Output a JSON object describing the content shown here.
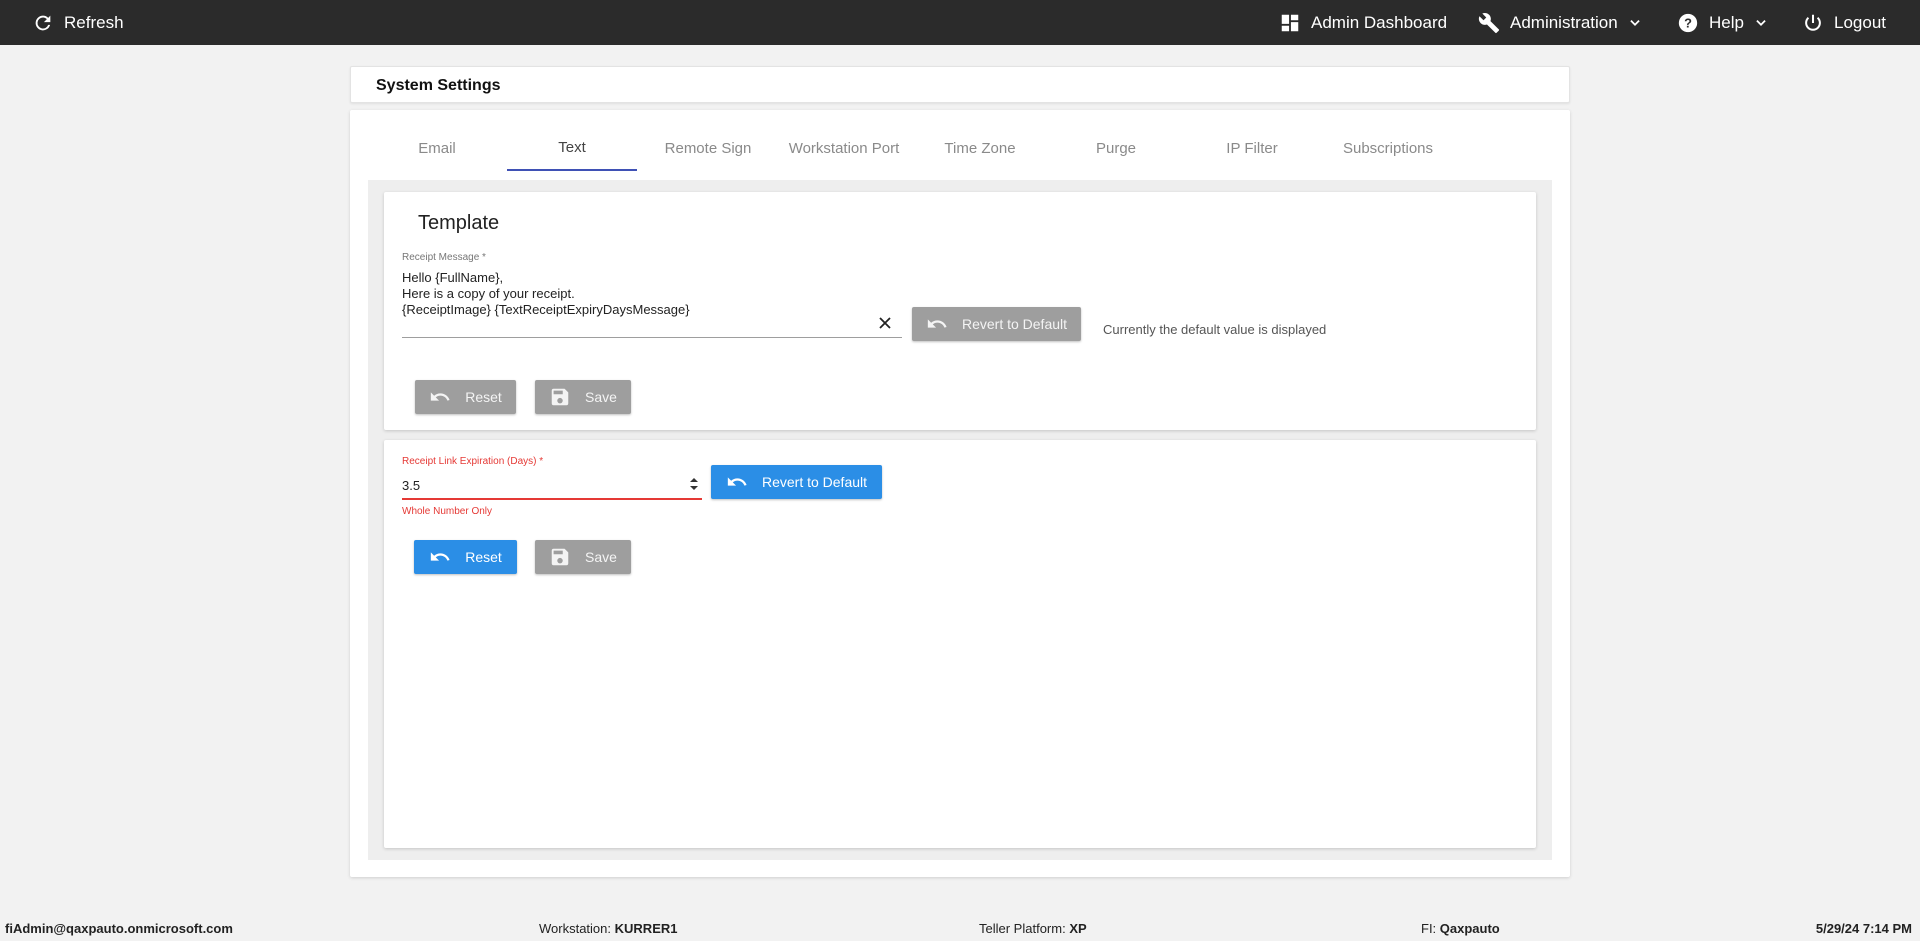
{
  "topbar": {
    "refresh_label": "Refresh",
    "admin_dashboard_label": "Admin Dashboard",
    "administration_label": "Administration",
    "help_label": "Help",
    "logout_label": "Logout",
    "icons": [
      "refresh-icon",
      "dashboard-icon",
      "wrench-icon",
      "help-circle-icon",
      "power-icon",
      "chevron-down-icon"
    ]
  },
  "page_title": "System Settings",
  "tabs": [
    {
      "label": "Email",
      "active": false
    },
    {
      "label": "Text",
      "active": true
    },
    {
      "label": "Remote Sign",
      "active": false
    },
    {
      "label": "Workstation Port",
      "active": false
    },
    {
      "label": "Time Zone",
      "active": false
    },
    {
      "label": "Purge",
      "active": false
    },
    {
      "label": "IP Filter",
      "active": false
    },
    {
      "label": "Subscriptions",
      "active": false
    }
  ],
  "template_section": {
    "title": "Template",
    "receipt_message_label": "Receipt Message *",
    "receipt_message_value": "Hello {FullName},\nHere is a copy of your receipt.\n{ReceiptImage} {TextReceiptExpiryDaysMessage}",
    "revert_label": "Revert to Default",
    "default_note": "Currently the default value is displayed",
    "reset_label": "Reset",
    "save_label": "Save"
  },
  "expiration_section": {
    "label": "Receipt Link Expiration (Days) *",
    "value": "3.5",
    "error": "Whole Number Only",
    "revert_label": "Revert to Default",
    "reset_label": "Reset",
    "save_label": "Save"
  },
  "footer": {
    "user": "fiAdmin@qaxpauto.onmicrosoft.com",
    "workstation_label": "Workstation:",
    "workstation_value": "KURRER1",
    "platform_label": "Teller Platform:",
    "platform_value": "XP",
    "fi_label": "FI:",
    "fi_value": "Qaxpauto",
    "datetime": "5/29/24 7:14 PM"
  },
  "colors": {
    "topbar_bg": "#2b2b2b",
    "accent_blue": "#2b8ee6",
    "tab_indicator": "#3f51b5",
    "error_red": "#e53935",
    "disabled_grey": "#9e9e9e"
  }
}
